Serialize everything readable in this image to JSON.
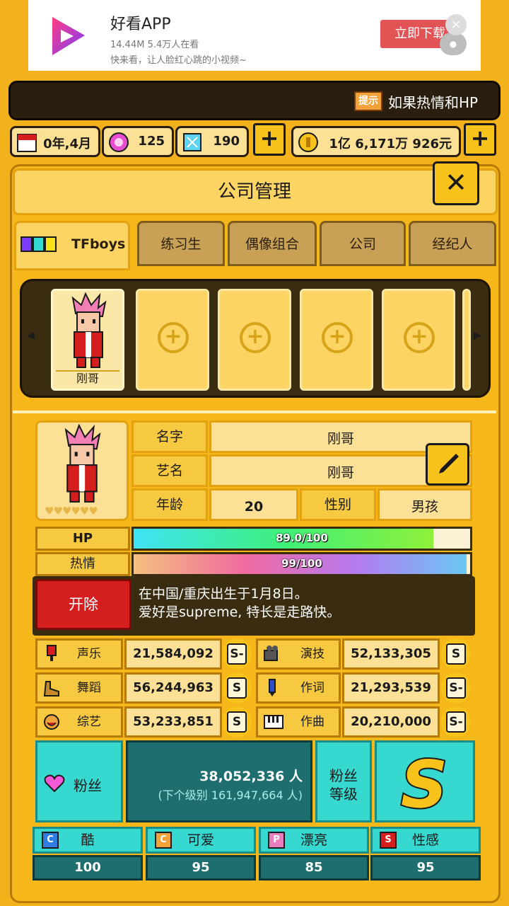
{
  "ad": {
    "title": "好看APP",
    "meta": "14.44M 5.4万人在看",
    "desc": "快来看，让人脸红心跳的小视频~",
    "download": "立即下载",
    "close": "×"
  },
  "tip": {
    "icon": "提示",
    "text": "如果热情和HP"
  },
  "resources": {
    "date": "0年,4月",
    "gems_pink": "125",
    "gems_blue": "190",
    "money": "1亿 6,171万 926元"
  },
  "panel": {
    "title": "公司管理"
  },
  "tabs": [
    {
      "label": "TFboys",
      "active": true
    },
    {
      "label": "练习生"
    },
    {
      "label": "偶像组合"
    },
    {
      "label": "公司"
    },
    {
      "label": "经纪人"
    }
  ],
  "roster": {
    "members": [
      {
        "name": "刚哥"
      }
    ]
  },
  "profile": {
    "name_label": "名字",
    "name": "刚哥",
    "stage_label": "艺名",
    "stage_name": "刚哥",
    "age_label": "年龄",
    "age": "20",
    "gender_label": "性别",
    "gender": "男孩"
  },
  "bars": {
    "hp_label": "HP",
    "hp_text": "89.0/100",
    "hp_value": 89.0,
    "hp_max": 100,
    "passion_label": "热情",
    "passion_text": "99/100",
    "passion_value": 99,
    "passion_max": 100
  },
  "fire_label": "开除",
  "bio": {
    "line1": "在中国/重庆出生于1月8日。",
    "line2": "爱好是supreme, 特长是走路快。"
  },
  "stats": [
    {
      "label": "声乐",
      "value": "21,584,092",
      "grade": "S-"
    },
    {
      "label": "演技",
      "value": "52,133,305",
      "grade": "S"
    },
    {
      "label": "舞蹈",
      "value": "56,244,963",
      "grade": "S"
    },
    {
      "label": "作词",
      "value": "21,293,539",
      "grade": "S-"
    },
    {
      "label": "综艺",
      "value": "53,233,851",
      "grade": "S"
    },
    {
      "label": "作曲",
      "value": "20,210,000",
      "grade": "S-"
    }
  ],
  "fans": {
    "label": "粉丝",
    "count": "38,052,336 人",
    "next": "(下个级别 161,947,664 人)",
    "level_label_1": "粉丝",
    "level_label_2": "等级",
    "level": "S"
  },
  "attributes": [
    {
      "label": "酷",
      "icon": "C",
      "color": "#2f7de0",
      "value": "100"
    },
    {
      "label": "可爱",
      "icon": "C",
      "color": "#f2a23a",
      "value": "95"
    },
    {
      "label": "漂亮",
      "icon": "P",
      "color": "#e77fbf",
      "value": "85"
    },
    {
      "label": "性感",
      "icon": "S",
      "color": "#d51f1f",
      "value": "95"
    }
  ]
}
